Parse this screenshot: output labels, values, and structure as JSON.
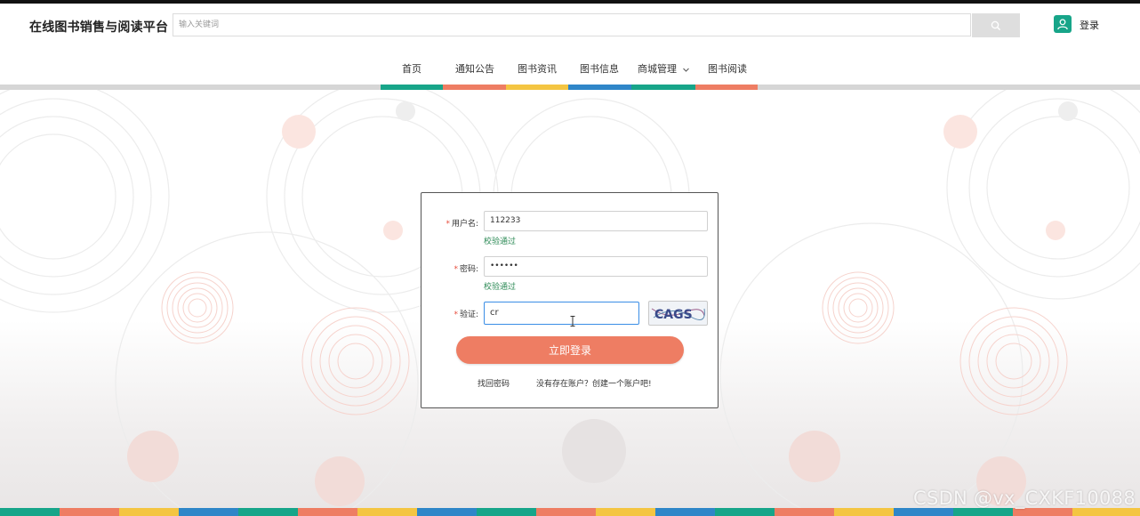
{
  "header": {
    "site_title": "在线图书销售与阅读平台",
    "search_placeholder": "输入关键词",
    "login_label": "登录"
  },
  "nav": {
    "items": [
      {
        "label": "首页",
        "color": "#17a589"
      },
      {
        "label": "通知公告",
        "color": "#ee7d63"
      },
      {
        "label": "图书资讯",
        "color": "#f4c542"
      },
      {
        "label": "图书信息",
        "color": "#2f86c8"
      },
      {
        "label": "商城管理",
        "color": "#17a589",
        "has_dropdown": true
      },
      {
        "label": "图书阅读",
        "color": "#ee7d63"
      }
    ]
  },
  "login_form": {
    "username_label": "用户名:",
    "username_value": "112233",
    "username_status": "校验通过",
    "password_label": "密码:",
    "password_value": "••••••",
    "password_status": "校验通过",
    "captcha_label": "验证:",
    "captcha_value": "cr",
    "captcha_image_text": "CAGS",
    "submit_label": "立即登录",
    "forgot_password": "找回密码",
    "register_prompt": "没有存在账户？创建一个账户吧!"
  },
  "watermark": "CSDN @vx_CXKF10088",
  "colors": {
    "accent": "#ee7d63",
    "teal": "#17a589",
    "yellow": "#f4c542",
    "blue": "#2f86c8",
    "valid_green": "#2e8b57"
  }
}
